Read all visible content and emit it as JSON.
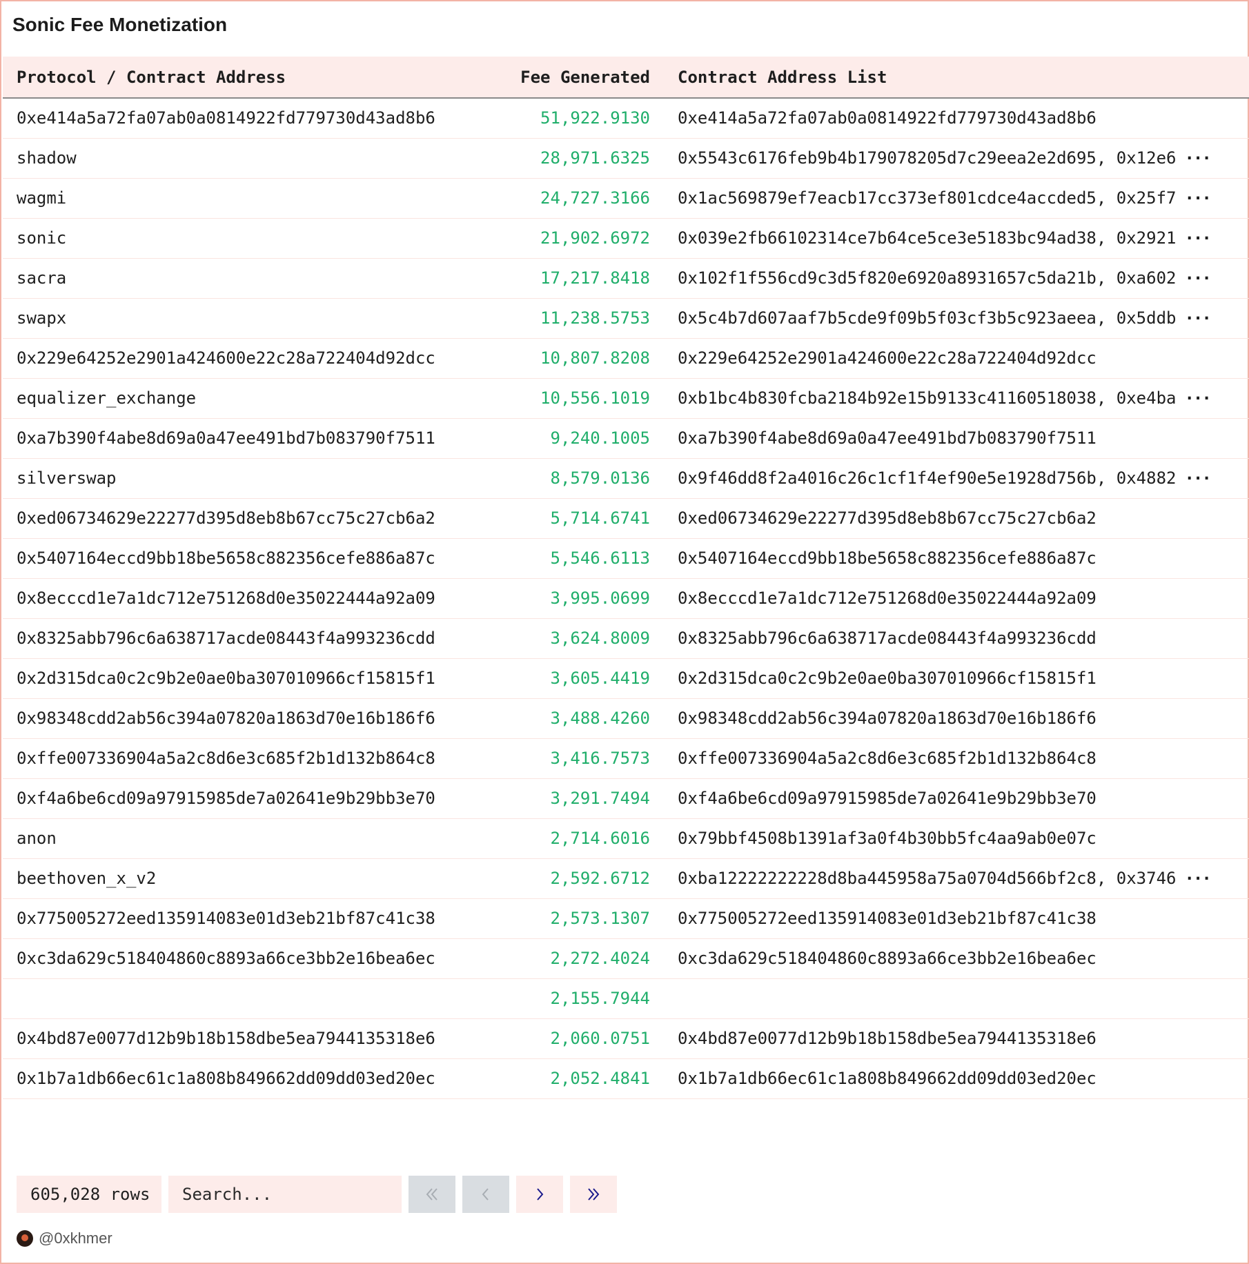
{
  "title": "Sonic Fee Monetization",
  "table": {
    "headers": [
      "Protocol / Contract Address",
      "Fee Generated",
      "Contract Address List"
    ],
    "rows": [
      {
        "protocol": "0xe414a5a72fa07ab0a0814922fd779730d43ad8b6",
        "fee": "51,922.9130",
        "list": "0xe414a5a72fa07ab0a0814922fd779730d43ad8b6",
        "more": ""
      },
      {
        "protocol": "shadow",
        "fee": "28,971.6325",
        "list": "0x5543c6176feb9b4b179078205d7c29eea2e2d695, 0x12e6",
        "more": "···"
      },
      {
        "protocol": "wagmi",
        "fee": "24,727.3166",
        "list": "0x1ac569879ef7eacb17cc373ef801cdce4accded5, 0x25f7",
        "more": "···"
      },
      {
        "protocol": "sonic",
        "fee": "21,902.6972",
        "list": "0x039e2fb66102314ce7b64ce5ce3e5183bc94ad38, 0x2921",
        "more": "···"
      },
      {
        "protocol": "sacra",
        "fee": "17,217.8418",
        "list": "0x102f1f556cd9c3d5f820e6920a8931657c5da21b, 0xa602",
        "more": "···"
      },
      {
        "protocol": "swapx",
        "fee": "11,238.5753",
        "list": "0x5c4b7d607aaf7b5cde9f09b5f03cf3b5c923aeea, 0x5ddb",
        "more": "···"
      },
      {
        "protocol": "0x229e64252e2901a424600e22c28a722404d92dcc",
        "fee": "10,807.8208",
        "list": "0x229e64252e2901a424600e22c28a722404d92dcc",
        "more": ""
      },
      {
        "protocol": "equalizer_exchange",
        "fee": "10,556.1019",
        "list": "0xb1bc4b830fcba2184b92e15b9133c41160518038, 0xe4ba",
        "more": "···"
      },
      {
        "protocol": "0xa7b390f4abe8d69a0a47ee491bd7b083790f7511",
        "fee": "9,240.1005",
        "list": "0xa7b390f4abe8d69a0a47ee491bd7b083790f7511",
        "more": ""
      },
      {
        "protocol": "silverswap",
        "fee": "8,579.0136",
        "list": "0x9f46dd8f2a4016c26c1cf1f4ef90e5e1928d756b, 0x4882",
        "more": "···"
      },
      {
        "protocol": "0xed06734629e22277d395d8eb8b67cc75c27cb6a2",
        "fee": "5,714.6741",
        "list": "0xed06734629e22277d395d8eb8b67cc75c27cb6a2",
        "more": ""
      },
      {
        "protocol": "0x5407164eccd9bb18be5658c882356cefe886a87c",
        "fee": "5,546.6113",
        "list": "0x5407164eccd9bb18be5658c882356cefe886a87c",
        "more": ""
      },
      {
        "protocol": "0x8ecccd1e7a1dc712e751268d0e35022444a92a09",
        "fee": "3,995.0699",
        "list": "0x8ecccd1e7a1dc712e751268d0e35022444a92a09",
        "more": ""
      },
      {
        "protocol": "0x8325abb796c6a638717acde08443f4a993236cdd",
        "fee": "3,624.8009",
        "list": "0x8325abb796c6a638717acde08443f4a993236cdd",
        "more": ""
      },
      {
        "protocol": "0x2d315dca0c2c9b2e0ae0ba307010966cf15815f1",
        "fee": "3,605.4419",
        "list": "0x2d315dca0c2c9b2e0ae0ba307010966cf15815f1",
        "more": ""
      },
      {
        "protocol": "0x98348cdd2ab56c394a07820a1863d70e16b186f6",
        "fee": "3,488.4260",
        "list": "0x98348cdd2ab56c394a07820a1863d70e16b186f6",
        "more": ""
      },
      {
        "protocol": "0xffe007336904a5a2c8d6e3c685f2b1d132b864c8",
        "fee": "3,416.7573",
        "list": "0xffe007336904a5a2c8d6e3c685f2b1d132b864c8",
        "more": ""
      },
      {
        "protocol": "0xf4a6be6cd09a97915985de7a02641e9b29bb3e70",
        "fee": "3,291.7494",
        "list": "0xf4a6be6cd09a97915985de7a02641e9b29bb3e70",
        "more": ""
      },
      {
        "protocol": "anon",
        "fee": "2,714.6016",
        "list": "0x79bbf4508b1391af3a0f4b30bb5fc4aa9ab0e07c",
        "more": ""
      },
      {
        "protocol": "beethoven_x_v2",
        "fee": "2,592.6712",
        "list": "0xba12222222228d8ba445958a75a0704d566bf2c8, 0x3746",
        "more": "···"
      },
      {
        "protocol": "0x775005272eed135914083e01d3eb21bf87c41c38",
        "fee": "2,573.1307",
        "list": "0x775005272eed135914083e01d3eb21bf87c41c38",
        "more": ""
      },
      {
        "protocol": "0xc3da629c518404860c8893a66ce3bb2e16bea6ec",
        "fee": "2,272.4024",
        "list": "0xc3da629c518404860c8893a66ce3bb2e16bea6ec",
        "more": ""
      },
      {
        "protocol": "",
        "fee": "2,155.7944",
        "list": "",
        "more": ""
      },
      {
        "protocol": "0x4bd87e0077d12b9b18b158dbe5ea7944135318e6",
        "fee": "2,060.0751",
        "list": "0x4bd87e0077d12b9b18b158dbe5ea7944135318e6",
        "more": ""
      },
      {
        "protocol": "0x1b7a1db66ec61c1a808b849662dd09dd03ed20ec",
        "fee": "2,052.4841",
        "list": "0x1b7a1db66ec61c1a808b849662dd09dd03ed20ec",
        "more": ""
      }
    ]
  },
  "footer": {
    "row_count": "605,028 rows",
    "search_placeholder": "Search...",
    "pager": {
      "first_icon": "double-chevron-left-icon",
      "prev_icon": "chevron-left-icon",
      "next_icon": "chevron-right-icon",
      "last_icon": "double-chevron-right-icon"
    }
  },
  "credit": {
    "handle": "@0xkhmer",
    "icon": "avatar-icon"
  },
  "colors": {
    "accent_bg": "#fdecea",
    "fee_green": "#1fae6a",
    "border": "#f3b3a6",
    "disabled_btn": "#d9dde1",
    "pager_enabled_icon": "#1a1a8c",
    "pager_disabled_icon": "#a8adb3"
  }
}
